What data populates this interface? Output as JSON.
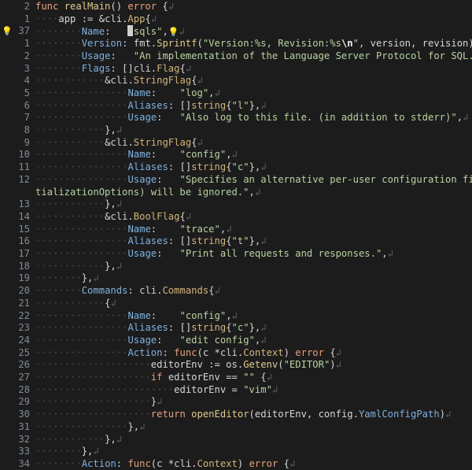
{
  "editor": {
    "colors": {
      "background": "#1c1c1c",
      "line_number": "#7f8a99",
      "keyword": "#e8a27a",
      "field": "#7fb2e0",
      "type": "#d2b47a",
      "string": "#b9d3a0",
      "function": "#e0cc8c"
    },
    "current_line_number": "37",
    "lines": [
      {
        "n": "2",
        "indent": 0,
        "t": [
          [
            "kw",
            "func "
          ],
          [
            "fn",
            "realMain"
          ],
          [
            "plain",
            "() "
          ],
          [
            "kw",
            "error"
          ],
          [
            "plain",
            " {"
          ]
        ]
      },
      {
        "n": "1",
        "indent": 1,
        "t": [
          [
            "plain",
            "app := &"
          ],
          [
            "pkg",
            "cli"
          ],
          [
            "plain",
            "."
          ],
          [
            "typ",
            "App"
          ],
          [
            "plain",
            "{"
          ]
        ]
      },
      {
        "n": "37",
        "indent": 2,
        "bulb": true,
        "t": [
          [
            "fld",
            "Name"
          ],
          [
            "plain",
            ":   "
          ],
          [
            "cursor",
            ""
          ],
          [
            "str",
            "\"sqls\""
          ],
          [
            "plain",
            ","
          ],
          [
            "bulb2",
            ""
          ]
        ]
      },
      {
        "n": "1",
        "indent": 2,
        "t": [
          [
            "fld",
            "Version"
          ],
          [
            "plain",
            ": fmt."
          ],
          [
            "fn",
            "Sprintf"
          ],
          [
            "plain",
            "("
          ],
          [
            "str",
            "\"Version:%s, Revision:%s"
          ],
          [
            "esc",
            "\\n"
          ],
          [
            "str",
            "\""
          ],
          [
            "plain",
            ", version, revision),"
          ]
        ]
      },
      {
        "n": "2",
        "indent": 2,
        "t": [
          [
            "fld",
            "Usage"
          ],
          [
            "plain",
            ":   "
          ],
          [
            "str",
            "\"An implementation of the Language Server Protocol for SQL.\""
          ],
          [
            "plain",
            ","
          ]
        ]
      },
      {
        "n": "3",
        "indent": 2,
        "t": [
          [
            "fld",
            "Flags"
          ],
          [
            "plain",
            ": []"
          ],
          [
            "pkg",
            "cli"
          ],
          [
            "plain",
            "."
          ],
          [
            "typ",
            "Flag"
          ],
          [
            "plain",
            "{"
          ]
        ]
      },
      {
        "n": "4",
        "indent": 3,
        "t": [
          [
            "plain",
            "&"
          ],
          [
            "pkg",
            "cli"
          ],
          [
            "plain",
            "."
          ],
          [
            "typ",
            "StringFlag"
          ],
          [
            "plain",
            "{"
          ]
        ]
      },
      {
        "n": "5",
        "indent": 4,
        "t": [
          [
            "fld",
            "Name"
          ],
          [
            "plain",
            ":    "
          ],
          [
            "str",
            "\"log\""
          ],
          [
            "plain",
            ","
          ]
        ]
      },
      {
        "n": "6",
        "indent": 4,
        "t": [
          [
            "fld",
            "Aliases"
          ],
          [
            "plain",
            ": []"
          ],
          [
            "typ",
            "string"
          ],
          [
            "plain",
            "{"
          ],
          [
            "str",
            "\"l\""
          ],
          [
            "plain",
            "},"
          ]
        ]
      },
      {
        "n": "7",
        "indent": 4,
        "t": [
          [
            "fld",
            "Usage"
          ],
          [
            "plain",
            ":   "
          ],
          [
            "str",
            "\"Also log to this file. (in addition to stderr)\""
          ],
          [
            "plain",
            ","
          ]
        ]
      },
      {
        "n": "8",
        "indent": 3,
        "t": [
          [
            "plain",
            "},"
          ]
        ]
      },
      {
        "n": "9",
        "indent": 3,
        "t": [
          [
            "plain",
            "&"
          ],
          [
            "pkg",
            "cli"
          ],
          [
            "plain",
            "."
          ],
          [
            "typ",
            "StringFlag"
          ],
          [
            "plain",
            "{"
          ]
        ]
      },
      {
        "n": "10",
        "indent": 4,
        "t": [
          [
            "fld",
            "Name"
          ],
          [
            "plain",
            ":    "
          ],
          [
            "str",
            "\"config\""
          ],
          [
            "plain",
            ","
          ]
        ]
      },
      {
        "n": "11",
        "indent": 4,
        "t": [
          [
            "fld",
            "Aliases"
          ],
          [
            "plain",
            ": []"
          ],
          [
            "typ",
            "string"
          ],
          [
            "plain",
            "{"
          ],
          [
            "str",
            "\"c\""
          ],
          [
            "plain",
            "},"
          ]
        ]
      },
      {
        "n": "12",
        "indent": 4,
        "nonl": true,
        "t": [
          [
            "fld",
            "Usage"
          ],
          [
            "plain",
            ":   "
          ],
          [
            "str",
            "\"Specifies an alternative per-user configuration file. If"
          ]
        ]
      },
      {
        "n": "",
        "indent": 0,
        "wrap": true,
        "t": [
          [
            "str",
            "tializationOptions) will be ignored.\""
          ],
          [
            "plain",
            ","
          ]
        ]
      },
      {
        "n": "13",
        "indent": 3,
        "t": [
          [
            "plain",
            "},"
          ]
        ]
      },
      {
        "n": "14",
        "indent": 3,
        "t": [
          [
            "plain",
            "&"
          ],
          [
            "pkg",
            "cli"
          ],
          [
            "plain",
            "."
          ],
          [
            "typ",
            "BoolFlag"
          ],
          [
            "plain",
            "{"
          ]
        ]
      },
      {
        "n": "15",
        "indent": 4,
        "t": [
          [
            "fld",
            "Name"
          ],
          [
            "plain",
            ":    "
          ],
          [
            "str",
            "\"trace\""
          ],
          [
            "plain",
            ","
          ]
        ]
      },
      {
        "n": "16",
        "indent": 4,
        "t": [
          [
            "fld",
            "Aliases"
          ],
          [
            "plain",
            ": []"
          ],
          [
            "typ",
            "string"
          ],
          [
            "plain",
            "{"
          ],
          [
            "str",
            "\"t\""
          ],
          [
            "plain",
            "},"
          ]
        ]
      },
      {
        "n": "17",
        "indent": 4,
        "t": [
          [
            "fld",
            "Usage"
          ],
          [
            "plain",
            ":   "
          ],
          [
            "str",
            "\"Print all requests and responses.\""
          ],
          [
            "plain",
            ","
          ]
        ]
      },
      {
        "n": "18",
        "indent": 3,
        "t": [
          [
            "plain",
            "},"
          ]
        ]
      },
      {
        "n": "19",
        "indent": 2,
        "t": [
          [
            "plain",
            "},"
          ]
        ]
      },
      {
        "n": "20",
        "indent": 2,
        "t": [
          [
            "fld",
            "Commands"
          ],
          [
            "plain",
            ": "
          ],
          [
            "pkg",
            "cli"
          ],
          [
            "plain",
            "."
          ],
          [
            "typ",
            "Commands"
          ],
          [
            "plain",
            "{"
          ]
        ]
      },
      {
        "n": "21",
        "indent": 3,
        "t": [
          [
            "plain",
            "{"
          ]
        ]
      },
      {
        "n": "22",
        "indent": 4,
        "t": [
          [
            "fld",
            "Name"
          ],
          [
            "plain",
            ":    "
          ],
          [
            "str",
            "\"config\""
          ],
          [
            "plain",
            ","
          ]
        ]
      },
      {
        "n": "23",
        "indent": 4,
        "t": [
          [
            "fld",
            "Aliases"
          ],
          [
            "plain",
            ": []"
          ],
          [
            "typ",
            "string"
          ],
          [
            "plain",
            "{"
          ],
          [
            "str",
            "\"c\""
          ],
          [
            "plain",
            "},"
          ]
        ]
      },
      {
        "n": "24",
        "indent": 4,
        "t": [
          [
            "fld",
            "Usage"
          ],
          [
            "plain",
            ":   "
          ],
          [
            "str",
            "\"edit config\""
          ],
          [
            "plain",
            ","
          ]
        ]
      },
      {
        "n": "25",
        "indent": 4,
        "t": [
          [
            "fld",
            "Action"
          ],
          [
            "plain",
            ": "
          ],
          [
            "kw",
            "func"
          ],
          [
            "plain",
            "(c *"
          ],
          [
            "pkg",
            "cli"
          ],
          [
            "plain",
            "."
          ],
          [
            "typ",
            "Context"
          ],
          [
            "plain",
            ") "
          ],
          [
            "kw",
            "error"
          ],
          [
            "plain",
            " {"
          ]
        ]
      },
      {
        "n": "26",
        "indent": 5,
        "t": [
          [
            "plain",
            "editorEnv := os."
          ],
          [
            "fn",
            "Getenv"
          ],
          [
            "plain",
            "("
          ],
          [
            "str",
            "\"EDITOR\""
          ],
          [
            "plain",
            ")"
          ]
        ]
      },
      {
        "n": "27",
        "indent": 5,
        "t": [
          [
            "kw",
            "if"
          ],
          [
            "plain",
            " editorEnv == "
          ],
          [
            "str",
            "\"\""
          ],
          [
            "plain",
            " {"
          ]
        ]
      },
      {
        "n": "28",
        "indent": 6,
        "t": [
          [
            "plain",
            "editorEnv = "
          ],
          [
            "str",
            "\"vim\""
          ]
        ]
      },
      {
        "n": "29",
        "indent": 5,
        "t": [
          [
            "plain",
            "}"
          ]
        ]
      },
      {
        "n": "30",
        "indent": 5,
        "t": [
          [
            "kw",
            "return "
          ],
          [
            "fn",
            "openEditor"
          ],
          [
            "plain",
            "(editorEnv, config."
          ],
          [
            "fld",
            "YamlConfigPath"
          ],
          [
            "plain",
            ")"
          ]
        ]
      },
      {
        "n": "31",
        "indent": 4,
        "t": [
          [
            "plain",
            "},"
          ]
        ]
      },
      {
        "n": "32",
        "indent": 3,
        "t": [
          [
            "plain",
            "},"
          ]
        ]
      },
      {
        "n": "33",
        "indent": 2,
        "t": [
          [
            "plain",
            "},"
          ]
        ]
      },
      {
        "n": "34",
        "indent": 2,
        "t": [
          [
            "fld",
            "Action"
          ],
          [
            "plain",
            ": "
          ],
          [
            "kw",
            "func"
          ],
          [
            "plain",
            "(c *"
          ],
          [
            "pkg",
            "cli"
          ],
          [
            "plain",
            "."
          ],
          [
            "typ",
            "Context"
          ],
          [
            "plain",
            ") "
          ],
          [
            "kw",
            "error"
          ],
          [
            "plain",
            " {"
          ]
        ]
      }
    ]
  }
}
